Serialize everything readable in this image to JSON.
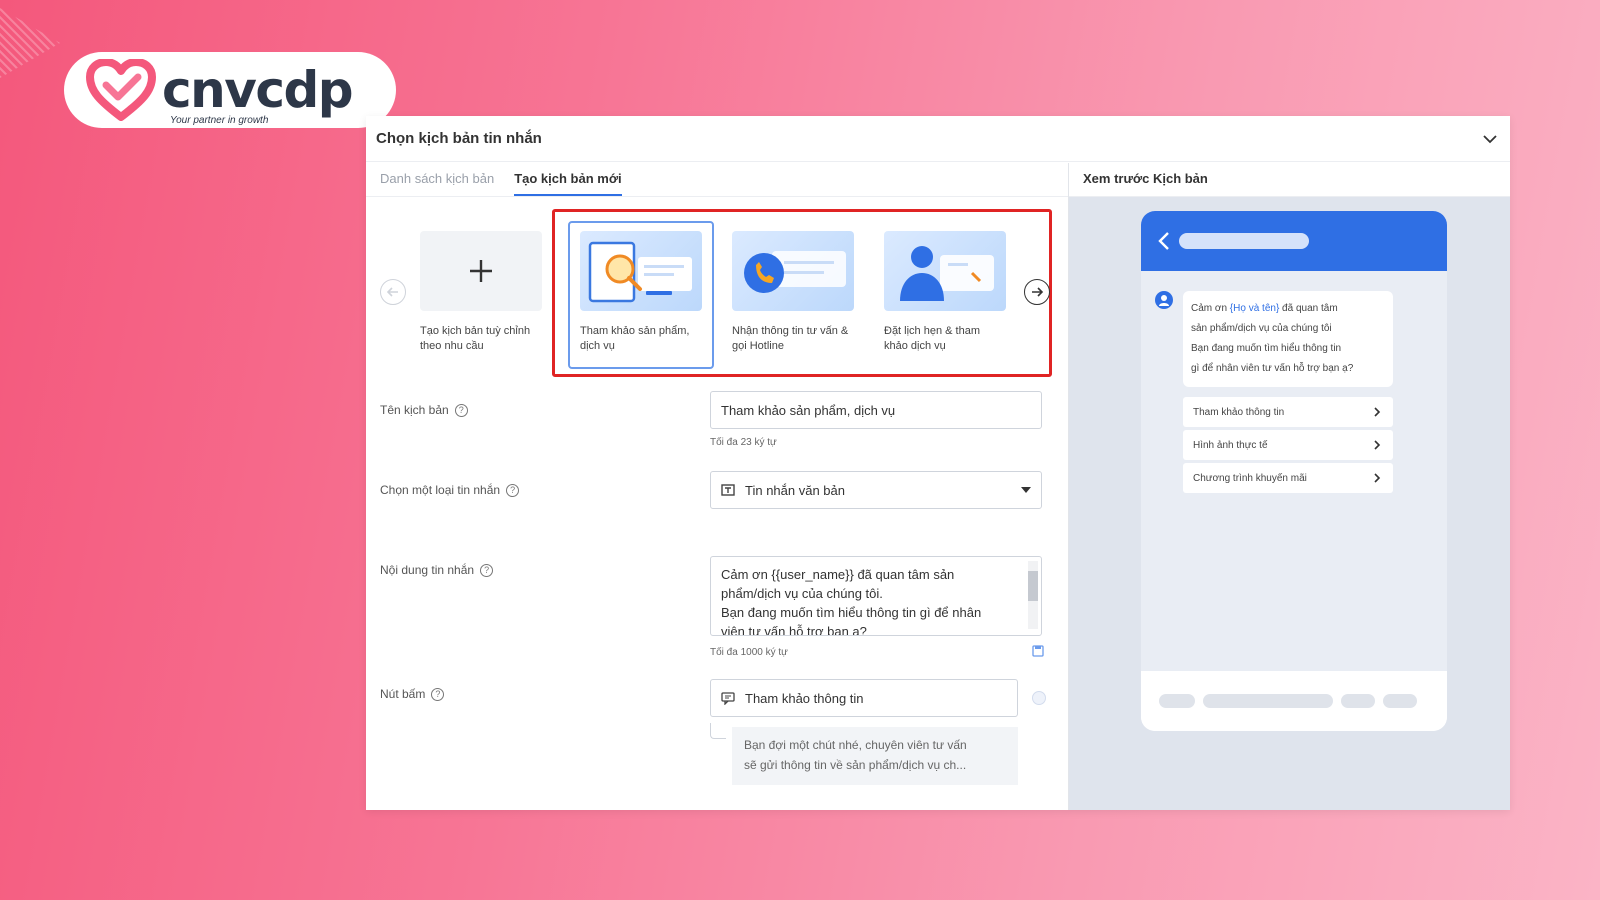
{
  "brand": {
    "name": "cnvcdp",
    "tagline": "Your partner in growth",
    "accent": "#f4587c"
  },
  "panel": {
    "title": "Chọn kịch bản tin nhắn",
    "tabs": [
      {
        "label": "Danh sách kịch bản",
        "active": false
      },
      {
        "label": "Tạo kịch bản mới",
        "active": true
      }
    ],
    "preview_title": "Xem trước Kịch bản"
  },
  "templates": [
    {
      "label": "Tạo kịch bản tuỳ chỉnh theo nhu cầu",
      "icon": "plus-icon"
    },
    {
      "label": "Tham khảo sản phẩm, dịch vụ",
      "icon": "magnifier-document-icon",
      "selected": true
    },
    {
      "label": "Nhận thông tin tư vấn & gọi Hotline",
      "icon": "phone-call-icon"
    },
    {
      "label": "Đặt lịch hẹn & tham khảo dịch vụ",
      "icon": "person-calendar-icon"
    }
  ],
  "form": {
    "name_label": "Tên kịch bản",
    "name_value": "Tham khảo sản phẩm, dịch vụ",
    "name_hint": "Tối đa 23 ký tự",
    "type_label": "Chọn một loại tin nhắn",
    "type_value": "Tin nhắn văn bản",
    "content_label": "Nội dung tin nhắn",
    "content_lines": [
      "Cảm ơn {{user_name}} đã quan tâm sản",
      "phẩm/dịch vụ của chúng tôi.",
      "Bạn đang muốn tìm hiểu thông tin gì để nhân",
      "viên tư vấn hỗ trợ bạn ạ?"
    ],
    "content_hint": "Tối đa 1000 ký tự",
    "button_label": "Nút bấm",
    "button_value": "Tham khảo thông tin",
    "button_reply_lines": [
      "Bạn đợi một chút nhé, chuyên viên tư vấn",
      "sẽ gửi thông tin về sản phẩm/dịch vụ ch..."
    ]
  },
  "preview": {
    "bubble_prefix": "Cảm ơn ",
    "bubble_highlight": "{Họ và tên}",
    "bubble_lines": [
      " đã quan tâm",
      "sản phẩm/dịch vụ của chúng tôi",
      "Bạn đang muốn tìm hiểu thông tin",
      "gì để nhân viên tư vấn hỗ trợ bạn ạ?"
    ],
    "quick_replies": [
      "Tham khảo thông tin",
      "Hình ảnh thực tế",
      "Chương trình khuyến mãi"
    ]
  }
}
